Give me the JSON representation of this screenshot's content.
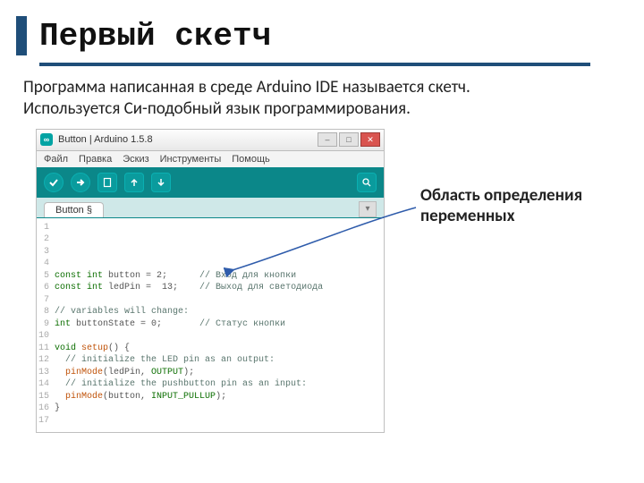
{
  "slide": {
    "title": "Первый скетч",
    "body_line1": "Программа написанная  в среде Arduino IDE называется скетч.",
    "body_line2": "Используется Си-подобный язык программирования."
  },
  "annotation": {
    "line1": "Область определения",
    "line2": "переменных"
  },
  "ide": {
    "window_title": "Button | Arduino 1.5.8",
    "app_icon_text": "∞",
    "menu": [
      "Файл",
      "Правка",
      "Эскиз",
      "Инструменты",
      "Помощь"
    ],
    "tab_name": "Button §",
    "code_lines": [
      {
        "n": "1",
        "html": ""
      },
      {
        "n": "2",
        "html": ""
      },
      {
        "n": "3",
        "html": ""
      },
      {
        "n": "4",
        "html": ""
      },
      {
        "n": "5",
        "html": "<span class='kw'>const int</span> button = 2;      <span class='pp'>// Вход для кнопки</span>"
      },
      {
        "n": "6",
        "html": "<span class='kw'>const int</span> ledPin =  13;    <span class='pp'>// Выход для светодиода</span>"
      },
      {
        "n": "7",
        "html": ""
      },
      {
        "n": "8",
        "html": "<span class='pp'>// variables will change:</span>"
      },
      {
        "n": "9",
        "html": "<span class='kw'>int</span> buttonState = 0;       <span class='pp'>// Статус кнопки</span>"
      },
      {
        "n": "10",
        "html": ""
      },
      {
        "n": "11",
        "html": "<span class='kw'>void</span> <span class='fn'>setup</span>() {"
      },
      {
        "n": "12",
        "html": "  <span class='pp'>// initialize the LED pin as an output:</span>"
      },
      {
        "n": "13",
        "html": "  <span class='fn'>pinMode</span>(ledPin, <span class='kw'>OUTPUT</span>);"
      },
      {
        "n": "14",
        "html": "  <span class='pp'>// initialize the pushbutton pin as an input:</span>"
      },
      {
        "n": "15",
        "html": "  <span class='fn'>pinMode</span>(button, <span class='kw'>INPUT_PULLUP</span>);"
      },
      {
        "n": "16",
        "html": "}"
      },
      {
        "n": "17",
        "html": ""
      }
    ]
  }
}
